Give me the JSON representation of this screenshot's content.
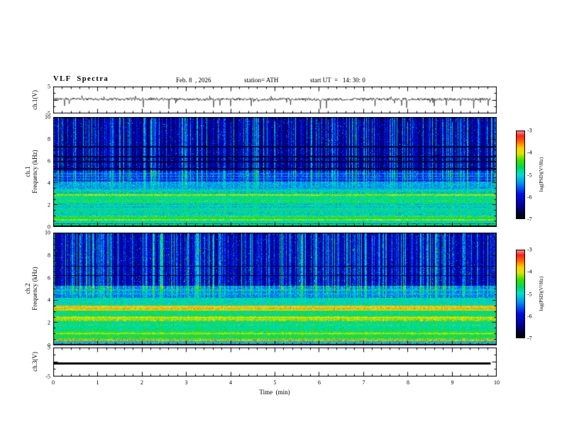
{
  "header": {
    "title": "VLF  Spectra",
    "date": "Feb. 8  , 2026",
    "station": "station= ATH",
    "start_ut": "start UT  =   14: 30: 0"
  },
  "xaxis": {
    "label": "Time  (min)",
    "ticks": [
      "0",
      "1",
      "2",
      "3",
      "4",
      "5",
      "6",
      "7",
      "8",
      "9",
      "10"
    ],
    "lim": [
      0,
      10
    ],
    "minor_step": 0.2
  },
  "colorbar": {
    "label": "log(PSD)(V²/Hz)",
    "ticks": [
      "-3",
      "-4",
      "-5",
      "-6",
      "-7"
    ],
    "lim": [
      -7,
      -3
    ]
  },
  "panels": {
    "wave": {
      "ylabel": "ch.1(V)",
      "yticks": [
        "5",
        "-5"
      ],
      "ylim": [
        -5,
        5
      ]
    },
    "spec1": {
      "ylabel1": "ch.1",
      "ylabel2": "Frequency (kHz)",
      "yticks": [
        "10",
        "8",
        "6",
        "4",
        "2",
        "0"
      ],
      "ylim": [
        0,
        10
      ]
    },
    "spec2": {
      "ylabel1": "ch.2",
      "ylabel2": "Frequency (kHz)",
      "yticks": [
        "10",
        "8",
        "6",
        "4",
        "2",
        "0"
      ],
      "ylim": [
        0,
        10
      ]
    },
    "ch3": {
      "ylabel": "ch.3(V)",
      "yticks": [
        "5",
        "-5"
      ],
      "ylim": [
        -5,
        5
      ]
    }
  },
  "colormap": {
    "stops": [
      [
        0.0,
        "#000000"
      ],
      [
        0.06,
        "#000030"
      ],
      [
        0.14,
        "#000090"
      ],
      [
        0.28,
        "#0010e8"
      ],
      [
        0.4,
        "#0090f0"
      ],
      [
        0.5,
        "#00e0d0"
      ],
      [
        0.58,
        "#00d860"
      ],
      [
        0.66,
        "#40e000"
      ],
      [
        0.74,
        "#d8e800"
      ],
      [
        0.8,
        "#ffd000"
      ],
      [
        0.87,
        "#ff7000"
      ],
      [
        0.94,
        "#ff2020"
      ],
      [
        1.0,
        "#ff9c9c"
      ]
    ]
  },
  "chart_data": [
    {
      "type": "line",
      "name": "ch1_waveform",
      "ylabel": "ch.1(V)",
      "ylim": [
        -5,
        5
      ],
      "xlim": [
        0,
        10
      ],
      "mean": 0.3,
      "noise_amp": 1.3,
      "spike_prob": 0.03,
      "spike_depth": [
        -1.5,
        -4.8
      ],
      "summary": "broadband noise around 0 V (~±0.7 V) with frequent impulsive negative spikes (sferics) reaching -3 to -5 V across the full 10 min record"
    },
    {
      "type": "heatmap",
      "name": "ch1_spectrogram",
      "xlim": [
        0,
        10
      ],
      "ylim": [
        0,
        10
      ],
      "zlim": [
        -7,
        -3
      ],
      "zlabel": "log(PSD)(V²/Hz)",
      "bands": [
        {
          "f": [
            0,
            0.12
          ],
          "level": -7.0
        },
        {
          "f": [
            0.12,
            0.3
          ],
          "level": -5.6
        },
        {
          "f": [
            0.3,
            0.55
          ],
          "level": -4.9
        },
        {
          "f": [
            0.55,
            0.8
          ],
          "level": -4.6
        },
        {
          "f": [
            0.8,
            1.05
          ],
          "level": -4.8
        },
        {
          "f": [
            1.05,
            1.35
          ],
          "level": -5.1
        },
        {
          "f": [
            1.35,
            1.75
          ],
          "level": -5.0
        },
        {
          "f": [
            1.75,
            2.1
          ],
          "level": -5.2
        },
        {
          "f": [
            2.1,
            2.45
          ],
          "level": -4.8
        },
        {
          "f": [
            2.45,
            2.8
          ],
          "level": -4.9
        },
        {
          "f": [
            2.8,
            3.05
          ],
          "level": -4.5
        },
        {
          "f": [
            3.05,
            3.5
          ],
          "level": -5.2
        },
        {
          "f": [
            3.5,
            4.15
          ],
          "level": -5.35
        },
        {
          "f": [
            4.15,
            5.1
          ],
          "level": -5.9
        },
        {
          "f": [
            5.1,
            10.01
          ],
          "level": -6.45
        }
      ],
      "lines": [
        {
          "f": 0.2,
          "level": -4.6
        },
        {
          "f": 0.65,
          "level": -4.2
        },
        {
          "f": 0.95,
          "level": -4.4
        },
        {
          "f": 1.5,
          "level": -4.6
        },
        {
          "f": 1.95,
          "level": -4.7
        },
        {
          "f": 2.35,
          "level": -4.4
        },
        {
          "f": 2.9,
          "level": -4.2
        },
        {
          "f": 3.3,
          "level": -4.8
        },
        {
          "f": 4.35,
          "level": -5.4
        },
        {
          "f": 4.6,
          "level": -5.3
        },
        {
          "f": 4.85,
          "level": -5.5
        }
      ],
      "dark_lines": [
        {
          "f": 5.3,
          "level": -6.75
        },
        {
          "f": 5.95,
          "level": -6.75
        },
        {
          "f": 6.4,
          "level": -6.7
        },
        {
          "f": 7.3,
          "level": -6.7
        }
      ],
      "streaks": {
        "fmin": 3.5,
        "max_boost": 1.7,
        "density": 0.6
      },
      "summary": "ch.1 VLF spectrogram: dark-blue background above ~5 kHz densely crossed by vertical sferic streaks (cyan/green); layered horizontal power bands below ~3 kHz in green/yellow; black band at 0 kHz"
    },
    {
      "type": "heatmap",
      "name": "ch2_spectrogram",
      "xlim": [
        0,
        10
      ],
      "ylim": [
        0,
        10
      ],
      "zlim": [
        -7,
        -3
      ],
      "zlabel": "log(PSD)(V²/Hz)",
      "bands": [
        {
          "f": [
            0,
            0.1
          ],
          "level": -7.0
        },
        {
          "f": [
            0.1,
            0.35
          ],
          "level": -5.2
        },
        {
          "f": [
            0.35,
            0.6
          ],
          "level": -4.4
        },
        {
          "f": [
            0.6,
            0.95
          ],
          "level": -4.7
        },
        {
          "f": [
            0.95,
            1.2
          ],
          "level": -4.4
        },
        {
          "f": [
            1.2,
            1.6
          ],
          "level": -4.8
        },
        {
          "f": [
            1.6,
            2.15
          ],
          "level": -4.9
        },
        {
          "f": [
            2.15,
            2.6
          ],
          "level": -4.3
        },
        {
          "f": [
            2.6,
            3.1
          ],
          "level": -4.8
        },
        {
          "f": [
            3.1,
            3.5
          ],
          "level": -4.0
        },
        {
          "f": [
            3.5,
            4.2
          ],
          "level": -5.0
        },
        {
          "f": [
            4.2,
            5.3
          ],
          "level": -5.5
        },
        {
          "f": [
            5.3,
            10.01
          ],
          "level": -6.35
        }
      ],
      "lines": [
        {
          "f": 0.45,
          "level": -3.65
        },
        {
          "f": 1.05,
          "level": -3.9
        },
        {
          "f": 1.8,
          "level": -4.4
        },
        {
          "f": 2.3,
          "level": -3.8
        },
        {
          "f": 2.45,
          "level": -4.0
        },
        {
          "f": 3.25,
          "level": -3.6
        },
        {
          "f": 3.4,
          "level": -3.8
        },
        {
          "f": 4.0,
          "level": -4.9
        },
        {
          "f": 4.55,
          "level": -5.1
        },
        {
          "f": 4.9,
          "level": -5.2
        }
      ],
      "dark_lines": [
        {
          "f": 6.2,
          "level": -6.7
        },
        {
          "f": 7.0,
          "level": -6.7
        }
      ],
      "streaks": {
        "fmin": 4.0,
        "max_boost": 1.7,
        "density": 0.62
      },
      "summary": "ch.2 VLF spectrogram: similar sferic streaks above ~5 kHz; stronger low-frequency structure with yellow/red bands near 0.45, 2.2-2.6 and 3.1-3.5 kHz; black band at 0 kHz"
    },
    {
      "type": "line",
      "name": "ch3_waveform",
      "ylabel": "ch.3(V)",
      "ylim": [
        -5,
        5
      ],
      "xlim": [
        0,
        10
      ],
      "value": -0.5,
      "summary": "constant flat trace at about -0.5 V (dead/flat channel) spanning 0 to ~9.9 min"
    }
  ]
}
